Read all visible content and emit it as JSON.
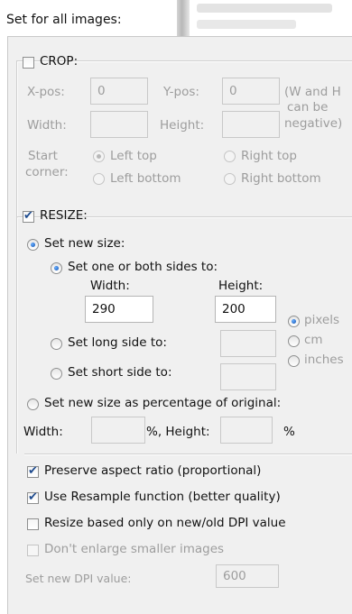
{
  "header": {
    "title": "Set for all images:"
  },
  "crop": {
    "label": "CROP:",
    "checked": false,
    "xpos_label": "X-pos:",
    "xpos_value": "0",
    "ypos_label": "Y-pos:",
    "ypos_value": "0",
    "note": "(W and H can be negative)",
    "note_line1": "(W and H",
    "note_line2": "can be",
    "note_line3": "negative)",
    "width_label": "Width:",
    "width_value": "",
    "height_label": "Height:",
    "height_value": "",
    "start_label_1": "Start",
    "start_label_2": "corner:",
    "corners": [
      "Left top",
      "Right top",
      "Left bottom",
      "Right bottom"
    ],
    "selected_corner": "Left top"
  },
  "resize": {
    "label": "RESIZE:",
    "checked": true,
    "set_new_size": "Set new size:",
    "set_one_or_both": "Set one or both sides to:",
    "width_label": "Width:",
    "height_label": "Height:",
    "width_value": "290",
    "height_value": "200",
    "units": [
      "pixels",
      "cm",
      "inches"
    ],
    "selected_unit": "pixels",
    "set_long_side": "Set long side to:",
    "set_short_side": "Set short side to:",
    "long_side_value": "",
    "short_side_value": "",
    "percentage_label": "Set new size as percentage of original:",
    "pct_width_label": "Width:",
    "pct_width_value": "",
    "pct_sep": "%, Height:",
    "pct_height_value": "",
    "pct_suffix": "%"
  },
  "options": {
    "preserve_aspect": "Preserve aspect ratio (proportional)",
    "preserve_aspect_checked": true,
    "use_resample": "Use Resample function (better quality)",
    "use_resample_checked": true,
    "resize_dpi": "Resize based only on new/old DPI value",
    "resize_dpi_checked": false,
    "dont_enlarge": "Don't enlarge smaller images",
    "dont_enlarge_checked": false,
    "dpi_label": "Set new DPI value:",
    "dpi_value": "600"
  },
  "colors": {
    "panel_bg": "#f0f0f0",
    "accent_check": "#1f4c8f",
    "radio_dot": "#0e4fb0"
  }
}
